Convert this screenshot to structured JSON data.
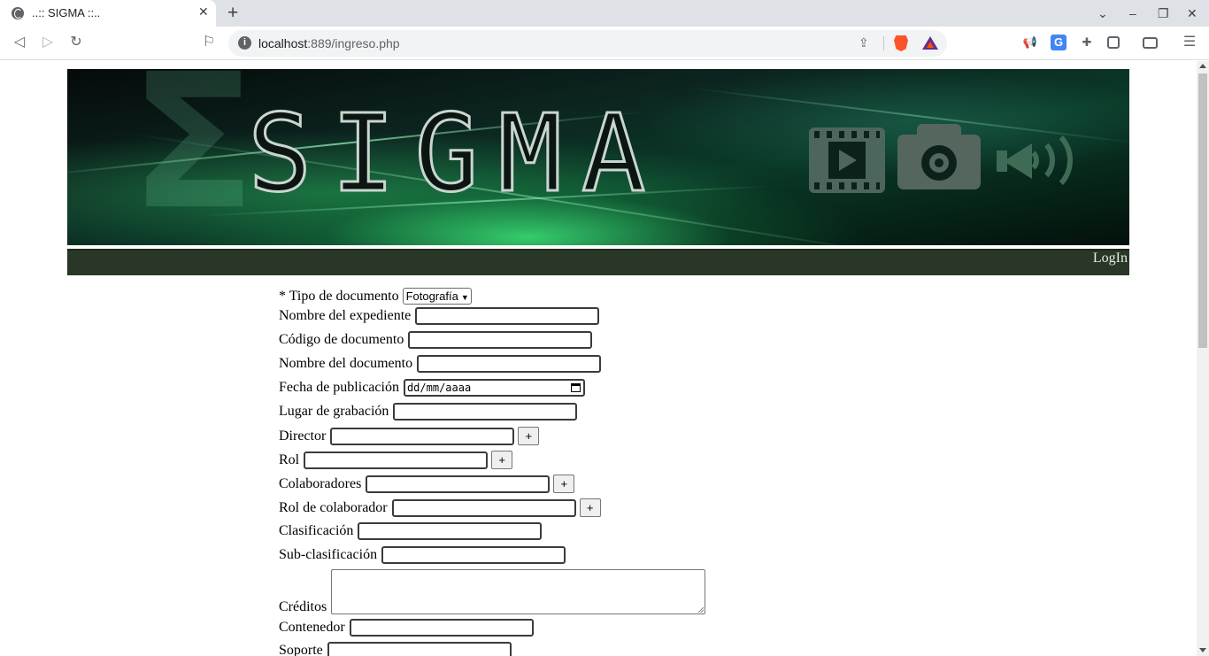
{
  "browser": {
    "tab_title": "..:: SIGMA ::..",
    "url_host": "localhost",
    "url_rest": ":889/ingreso.php"
  },
  "site": {
    "banner_title": "SIGMA",
    "sigma_symbol": "Σ",
    "nav_login": "LogIn"
  },
  "form": {
    "tipo_label": "* Tipo de documento",
    "tipo_selected": "Fotografía",
    "expediente_label": "Nombre del expediente",
    "codigo_label": "Código de documento",
    "nombre_doc_label": "Nombre del documento",
    "fecha_label": "Fecha de publicación",
    "fecha_placeholder": "dd/mm/aaaa",
    "lugar_label": "Lugar de grabación",
    "director_label": "Director",
    "rol_label": "Rol",
    "colaboradores_label": "Colaboradores",
    "rol_colaborador_label": "Rol de colaborador",
    "clasificacion_label": "Clasificación",
    "subclasificacion_label": "Sub-clasificación",
    "creditos_label": "Créditos",
    "contenedor_label": "Contenedor",
    "soporte_label": "Soporte",
    "add_button_label": "+"
  },
  "colors": {
    "navbar": "#283726",
    "banner_glow": "#3ce678",
    "login_text": "#e8ece6"
  }
}
